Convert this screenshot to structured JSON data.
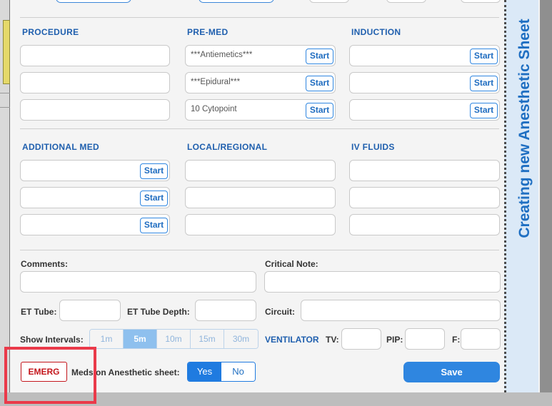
{
  "sidebar_title": "Creating new Anesthetic Sheet",
  "sections": {
    "procedure": "PROCEDURE",
    "premed": "PRE-MED",
    "induction": "INDUCTION",
    "additional_med": "ADDITIONAL MED",
    "local_regional": "LOCAL/REGIONAL",
    "iv_fluids": "IV FLUIDS"
  },
  "premed_values": [
    "***Antiemetics***",
    "***Epidural***",
    "10 Cytopoint"
  ],
  "start_label": "Start",
  "labels": {
    "comments": "Comments:",
    "critical_note": "Critical Note:",
    "et_tube": "ET Tube:",
    "et_tube_depth": "ET Tube Depth:",
    "circuit": "Circuit:",
    "show_intervals": "Show Intervals:",
    "ventilator": "VENTILATOR",
    "tv": "TV:",
    "pip": "PIP:",
    "f": "F:",
    "meds_on_sheet": "Meds on Anesthetic sheet:"
  },
  "intervals": [
    "1m",
    "5m",
    "10m",
    "15m",
    "30m"
  ],
  "selected_interval": "5m",
  "emerg_label": "EMERG",
  "yes_label": "Yes",
  "no_label": "No",
  "meds_selected": "Yes",
  "save_label": "Save",
  "colors": {
    "accent": "#2f86e0",
    "section_heading": "#1f5fae",
    "emerg": "#c4161c",
    "highlight_box": "#ea3a4a",
    "sidebar_bg": "#dbe9f7"
  }
}
